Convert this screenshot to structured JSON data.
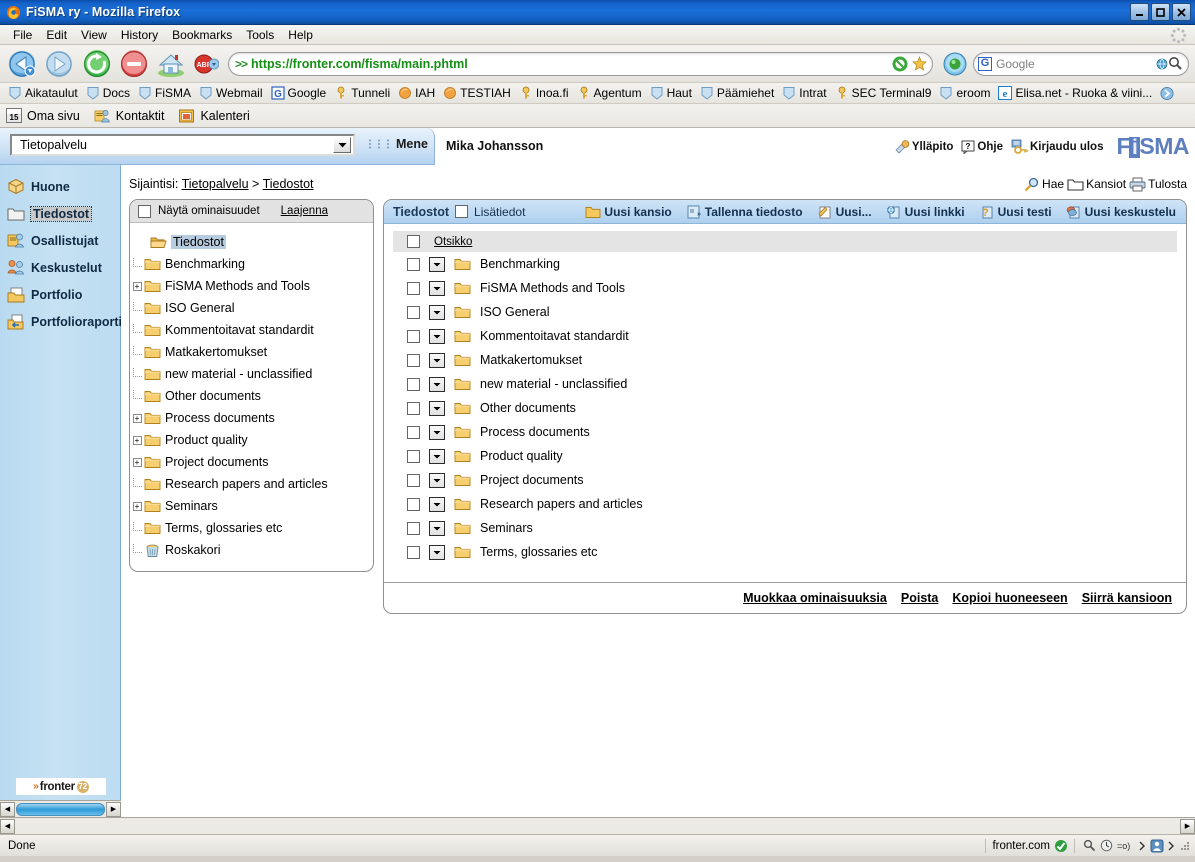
{
  "window": {
    "title": "FiSMA ry - Mozilla Firefox",
    "minimize_label": "_",
    "maximize_label": "☐",
    "close_label": "✕"
  },
  "menubar": {
    "items": [
      "File",
      "Edit",
      "View",
      "History",
      "Bookmarks",
      "Tools",
      "Help"
    ]
  },
  "navbar": {
    "back_title": "Back",
    "forward_title": "Forward",
    "reload_title": "Reload",
    "stop_title": "Stop",
    "home_title": "Home",
    "adblock_title": "AdBlock Plus",
    "url_prefix": ">>",
    "url": "https://fronter.com/fisma/main.phtml",
    "search_engine": "Google",
    "search_engine_letter": "G",
    "search_placeholder": "Google"
  },
  "bookmarks": {
    "items": [
      {
        "label": "Aikataulut",
        "icon": "bookmark-icon"
      },
      {
        "label": "Docs",
        "icon": "bookmark-icon"
      },
      {
        "label": "FiSMA",
        "icon": "bookmark-icon"
      },
      {
        "label": "Webmail",
        "icon": "bookmark-icon"
      },
      {
        "label": "Google",
        "icon": "google-icon"
      },
      {
        "label": "Tunneli",
        "icon": "key-icon"
      },
      {
        "label": "IAH",
        "icon": "orange-icon"
      },
      {
        "label": "TESTIAH",
        "icon": "orange-icon"
      },
      {
        "label": "Inoa.fi",
        "icon": "key-icon"
      },
      {
        "label": "Agentum",
        "icon": "key-icon"
      },
      {
        "label": "Haut",
        "icon": "bookmark-icon"
      },
      {
        "label": "Päämiehet",
        "icon": "bookmark-icon"
      },
      {
        "label": "Intrat",
        "icon": "bookmark-icon"
      },
      {
        "label": "SEC Terminal9",
        "icon": "key-icon"
      },
      {
        "label": "eroom",
        "icon": "bookmark-icon"
      },
      {
        "label": "Elisa.net - Ruoka & viini...",
        "icon": "ie-icon"
      }
    ],
    "overflow_icon": "chevron-right-icon"
  },
  "personal_toolbar": {
    "items": [
      {
        "label": "Oma sivu",
        "icon": "calendar-15-icon",
        "badge": "15"
      },
      {
        "label": "Kontaktit",
        "icon": "contacts-icon"
      },
      {
        "label": "Kalenteri",
        "icon": "calendar-icon"
      }
    ]
  },
  "app_header": {
    "room_select_value": "Tietopalvelu",
    "go_button": "Mene",
    "user_name": "Mika Johansson",
    "links": [
      {
        "label": "Ylläpito",
        "icon": "admin-icon"
      },
      {
        "label": "Ohje",
        "icon": "help-icon"
      },
      {
        "label": "Kirjaudu ulos",
        "icon": "logout-key-icon"
      }
    ],
    "logo_before": "F",
    "logo_i": "i",
    "logo_after": "SMA"
  },
  "sidebar": {
    "items": [
      {
        "label": "Huone",
        "icon": "room-cube-icon",
        "selected": false
      },
      {
        "label": "Tiedostot",
        "icon": "folder-white-icon",
        "selected": true
      },
      {
        "label": "Osallistujat",
        "icon": "participants-icon",
        "selected": false
      },
      {
        "label": "Keskustelut",
        "icon": "discussions-icon",
        "selected": false
      },
      {
        "label": "Portfolio",
        "icon": "portfolio-icon",
        "selected": false
      },
      {
        "label": "Portfolioraportit",
        "icon": "portfolio-reports-icon",
        "selected": false
      }
    ],
    "fronter_logo": {
      "chev": "»",
      "word": "fronter",
      "badge": "72"
    }
  },
  "breadcrumb": {
    "label": "Sijaintisi:",
    "items": [
      "Tietopalvelu",
      "Tiedostot"
    ],
    "separator": ">"
  },
  "page_tools": [
    {
      "label": "Hae",
      "icon": "search-magnifier-icon"
    },
    {
      "label": "Kansiot",
      "icon": "folder-outline-icon"
    },
    {
      "label": "Tulosta",
      "icon": "printer-icon"
    }
  ],
  "tree_panel": {
    "show_properties_label": "Näytä ominaisuudet",
    "expand_link": "Laajenna",
    "show_properties_checked": false,
    "nodes": [
      {
        "label": "Tiedostot",
        "depth": 0,
        "expander": "none",
        "icon": "open-folder-icon",
        "selected": true
      },
      {
        "label": "Benchmarking",
        "depth": 1,
        "expander": "leaf",
        "icon": "folder-icon",
        "selected": false
      },
      {
        "label": "FiSMA Methods and Tools",
        "depth": 1,
        "expander": "plus",
        "icon": "folder-icon",
        "selected": false
      },
      {
        "label": "ISO General",
        "depth": 1,
        "expander": "leaf",
        "icon": "folder-icon",
        "selected": false
      },
      {
        "label": "Kommentoitavat standardit",
        "depth": 1,
        "expander": "leaf",
        "icon": "folder-icon",
        "selected": false
      },
      {
        "label": "Matkakertomukset",
        "depth": 1,
        "expander": "leaf",
        "icon": "folder-icon",
        "selected": false
      },
      {
        "label": "new material - unclassified",
        "depth": 1,
        "expander": "leaf",
        "icon": "folder-icon",
        "selected": false
      },
      {
        "label": "Other documents",
        "depth": 1,
        "expander": "leaf",
        "icon": "folder-icon",
        "selected": false
      },
      {
        "label": "Process documents",
        "depth": 1,
        "expander": "plus",
        "icon": "folder-icon",
        "selected": false
      },
      {
        "label": "Product quality",
        "depth": 1,
        "expander": "plus",
        "icon": "folder-icon",
        "selected": false
      },
      {
        "label": "Project documents",
        "depth": 1,
        "expander": "plus",
        "icon": "folder-icon",
        "selected": false
      },
      {
        "label": "Research papers and articles",
        "depth": 1,
        "expander": "leaf",
        "icon": "folder-icon",
        "selected": false
      },
      {
        "label": "Seminars",
        "depth": 1,
        "expander": "plus",
        "icon": "folder-icon",
        "selected": false
      },
      {
        "label": "Terms, glossaries etc",
        "depth": 1,
        "expander": "leaf",
        "icon": "folder-icon",
        "selected": false
      },
      {
        "label": "Roskakori",
        "depth": 1,
        "expander": "leaf",
        "icon": "trash-icon",
        "selected": false
      }
    ]
  },
  "list_panel": {
    "title": "Tiedostot",
    "extra_info_label": "Lisätiedot",
    "extra_info_checked": false,
    "toolbar": [
      {
        "label": "Uusi kansio",
        "icon": "new-folder-icon"
      },
      {
        "label": "Tallenna tiedosto",
        "icon": "upload-file-icon"
      },
      {
        "label": "Uusi...",
        "icon": "new-document-icon"
      },
      {
        "label": "Uusi linkki",
        "icon": "new-link-icon"
      },
      {
        "label": "Uusi testi",
        "icon": "new-test-icon"
      },
      {
        "label": "Uusi keskustelu",
        "icon": "new-discussion-icon"
      }
    ],
    "column_header": "Otsikko",
    "select_all_checked": false,
    "rows": [
      {
        "name": "Benchmarking",
        "icon": "folder-icon",
        "checked": false
      },
      {
        "name": "FiSMA Methods and Tools",
        "icon": "folder-icon",
        "checked": false
      },
      {
        "name": "ISO General",
        "icon": "folder-icon",
        "checked": false
      },
      {
        "name": "Kommentoitavat standardit",
        "icon": "folder-icon",
        "checked": false
      },
      {
        "name": "Matkakertomukset",
        "icon": "folder-icon",
        "checked": false
      },
      {
        "name": "new material - unclassified",
        "icon": "folder-icon",
        "checked": false
      },
      {
        "name": "Other documents",
        "icon": "folder-icon",
        "checked": false
      },
      {
        "name": "Process documents",
        "icon": "folder-icon",
        "checked": false
      },
      {
        "name": "Product quality",
        "icon": "folder-icon",
        "checked": false
      },
      {
        "name": "Project documents",
        "icon": "folder-icon",
        "checked": false
      },
      {
        "name": "Research papers and articles",
        "icon": "folder-icon",
        "checked": false
      },
      {
        "name": "Seminars",
        "icon": "folder-icon",
        "checked": false
      },
      {
        "name": "Terms, glossaries etc",
        "icon": "folder-icon",
        "checked": false
      }
    ],
    "footer_actions": [
      "Muokkaa ominaisuuksia",
      "Poista",
      "Kopioi huoneeseen",
      "Siirrä kansioon"
    ]
  },
  "statusbar": {
    "message": "Done",
    "site": "fronter.com",
    "site_icon": "security-icon"
  }
}
